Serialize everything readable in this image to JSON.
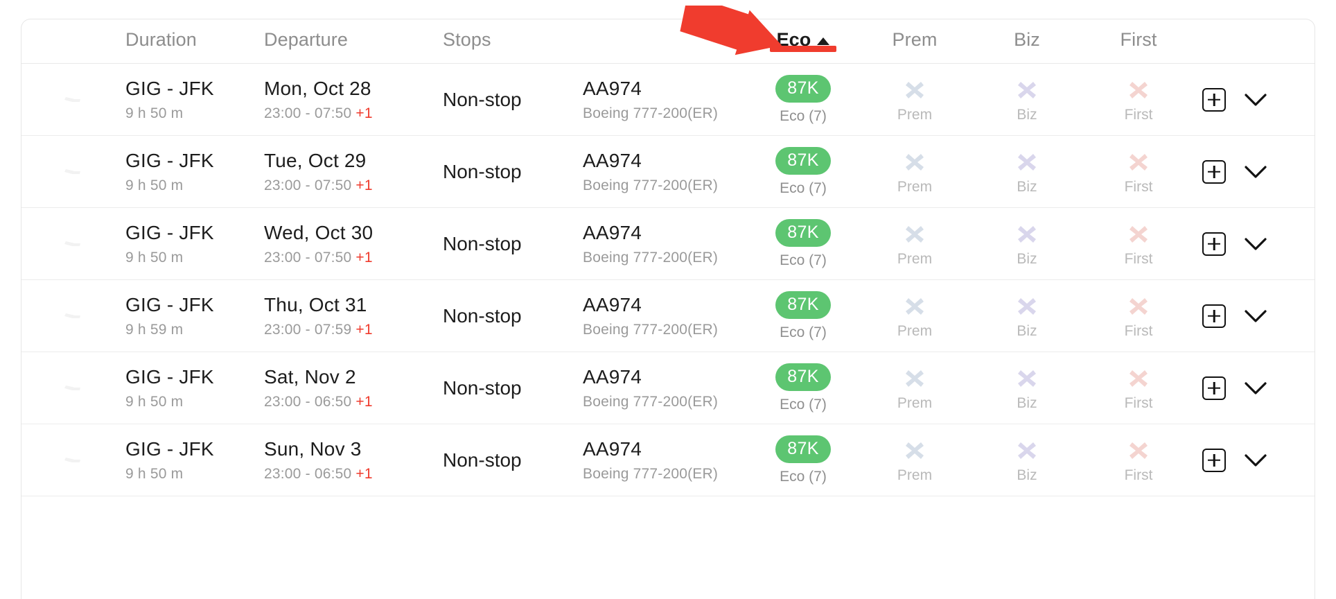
{
  "theme": {
    "accent_red": "#f03c2e",
    "fare_green": "#5dc571",
    "next_day_red": "#ef3b2d",
    "text_primary": "#1d1d1d",
    "text_muted": "#8f8f8f"
  },
  "table": {
    "columns": {
      "logo": "",
      "duration": "Duration",
      "departure": "Departure",
      "stops": "Stops",
      "flight": "",
      "eco": "Eco",
      "prem": "Prem",
      "biz": "Biz",
      "first": "First",
      "actions": ""
    },
    "sort": {
      "active_column": "Eco",
      "direction": "ascending",
      "caret": "caret-up-icon"
    },
    "rows": [
      {
        "airline_logo": "american-airlines-logo",
        "route": "GIG - JFK",
        "duration": "9 h 50 m",
        "date": "Mon, Oct 28",
        "times": "23:00 - 07:50 ",
        "next_day": "+1",
        "stops": "Non-stop",
        "flight_number": "AA974",
        "aircraft": "Boeing 777-200(ER)",
        "eco_price": "87K",
        "eco_label": "Eco (7)",
        "prem_label": "Prem",
        "biz_label": "Biz",
        "first_label": "First",
        "add_button": "add-to-compare-button",
        "expand_button": "expand-row-button"
      },
      {
        "airline_logo": "american-airlines-logo",
        "route": "GIG - JFK",
        "duration": "9 h 50 m",
        "date": "Tue, Oct 29",
        "times": "23:00 - 07:50 ",
        "next_day": "+1",
        "stops": "Non-stop",
        "flight_number": "AA974",
        "aircraft": "Boeing 777-200(ER)",
        "eco_price": "87K",
        "eco_label": "Eco (7)",
        "prem_label": "Prem",
        "biz_label": "Biz",
        "first_label": "First",
        "add_button": "add-to-compare-button",
        "expand_button": "expand-row-button"
      },
      {
        "airline_logo": "american-airlines-logo",
        "route": "GIG - JFK",
        "duration": "9 h 50 m",
        "date": "Wed, Oct 30",
        "times": "23:00 - 07:50 ",
        "next_day": "+1",
        "stops": "Non-stop",
        "flight_number": "AA974",
        "aircraft": "Boeing 777-200(ER)",
        "eco_price": "87K",
        "eco_label": "Eco (7)",
        "prem_label": "Prem",
        "biz_label": "Biz",
        "first_label": "First",
        "add_button": "add-to-compare-button",
        "expand_button": "expand-row-button"
      },
      {
        "airline_logo": "american-airlines-logo",
        "route": "GIG - JFK",
        "duration": "9 h 59 m",
        "date": "Thu, Oct 31",
        "times": "23:00 - 07:59 ",
        "next_day": "+1",
        "stops": "Non-stop",
        "flight_number": "AA974",
        "aircraft": "Boeing 777-200(ER)",
        "eco_price": "87K",
        "eco_label": "Eco (7)",
        "prem_label": "Prem",
        "biz_label": "Biz",
        "first_label": "First",
        "add_button": "add-to-compare-button",
        "expand_button": "expand-row-button"
      },
      {
        "airline_logo": "american-airlines-logo",
        "route": "GIG - JFK",
        "duration": "9 h 50 m",
        "date": "Sat, Nov 2",
        "times": "23:00 - 06:50 ",
        "next_day": "+1",
        "stops": "Non-stop",
        "flight_number": "AA974",
        "aircraft": "Boeing 777-200(ER)",
        "eco_price": "87K",
        "eco_label": "Eco (7)",
        "prem_label": "Prem",
        "biz_label": "Biz",
        "first_label": "First",
        "add_button": "add-to-compare-button",
        "expand_button": "expand-row-button"
      },
      {
        "airline_logo": "american-airlines-logo",
        "route": "GIG - JFK",
        "duration": "9 h 50 m",
        "date": "Sun, Nov 3",
        "times": "23:00 - 06:50 ",
        "next_day": "+1",
        "stops": "Non-stop",
        "flight_number": "AA974",
        "aircraft": "Boeing 777-200(ER)",
        "eco_price": "87K",
        "eco_label": "Eco (7)",
        "prem_label": "Prem",
        "biz_label": "Biz",
        "first_label": "First",
        "add_button": "add-to-compare-button",
        "expand_button": "expand-row-button"
      }
    ]
  },
  "annotation": {
    "arrow": "red-pointer-arrow",
    "points_at": "Eco"
  }
}
